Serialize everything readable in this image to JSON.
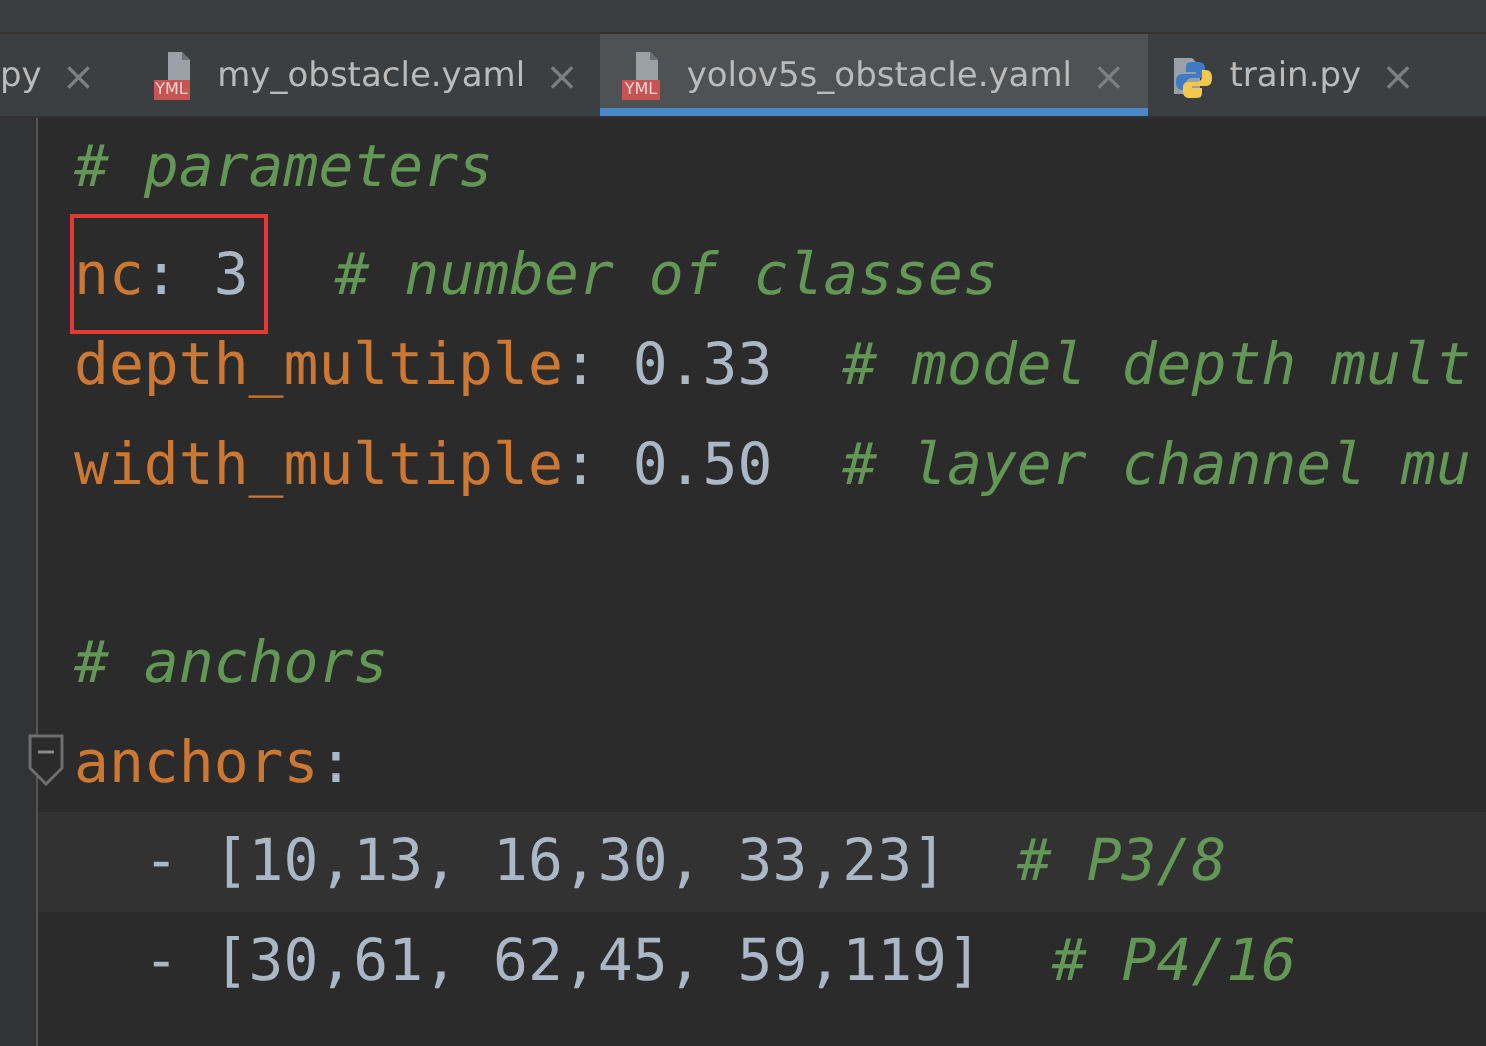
{
  "tabs": [
    {
      "label": "py",
      "selected": false
    },
    {
      "label": "my_obstacle.yaml",
      "kind": "yaml",
      "icon_label": "YML",
      "selected": false
    },
    {
      "label": "yolov5s_obstacle.yaml",
      "kind": "yaml",
      "icon_label": "YML",
      "selected": true
    },
    {
      "label": "train.py",
      "kind": "python",
      "selected": false
    }
  ],
  "close_glyph": "×",
  "editor": {
    "lines": [
      {
        "kind": "code",
        "tokens": [
          {
            "kind": "comment",
            "text": "# parameters"
          }
        ]
      },
      {
        "kind": "code",
        "tokens": [
          {
            "kind": "boxed",
            "tokens": [
              {
                "kind": "key",
                "text": "nc"
              },
              {
                "kind": "colon",
                "text": ":"
              },
              {
                "kind": "value",
                "text": " 3"
              }
            ]
          },
          {
            "kind": "comment",
            "text": "  # number of classes"
          }
        ]
      },
      {
        "kind": "code",
        "tokens": [
          {
            "kind": "key",
            "text": "depth_multiple"
          },
          {
            "kind": "colon",
            "text": ":"
          },
          {
            "kind": "value",
            "text": " 0.33"
          },
          {
            "kind": "comment",
            "text": "  # model depth mult"
          }
        ]
      },
      {
        "kind": "code",
        "tokens": [
          {
            "kind": "key",
            "text": "width_multiple"
          },
          {
            "kind": "colon",
            "text": ":"
          },
          {
            "kind": "value",
            "text": " 0.50"
          },
          {
            "kind": "comment",
            "text": "  # layer channel mu"
          }
        ]
      },
      {
        "kind": "blank"
      },
      {
        "kind": "code",
        "tokens": [
          {
            "kind": "comment",
            "text": "# anchors"
          }
        ]
      },
      {
        "kind": "code",
        "fold": true,
        "tokens": [
          {
            "kind": "key",
            "text": "anchors"
          },
          {
            "kind": "colon",
            "text": ":"
          }
        ]
      },
      {
        "kind": "code",
        "current": true,
        "tokens": [
          {
            "kind": "value",
            "text": "  - [10,13, 16,30, 33,23]"
          },
          {
            "kind": "comment",
            "text": "  # P3/8"
          }
        ]
      },
      {
        "kind": "code",
        "tokens": [
          {
            "kind": "value",
            "text": "  - [30,61, 62,45, 59,119]"
          },
          {
            "kind": "comment",
            "text": "  # P4/16"
          }
        ]
      }
    ]
  }
}
